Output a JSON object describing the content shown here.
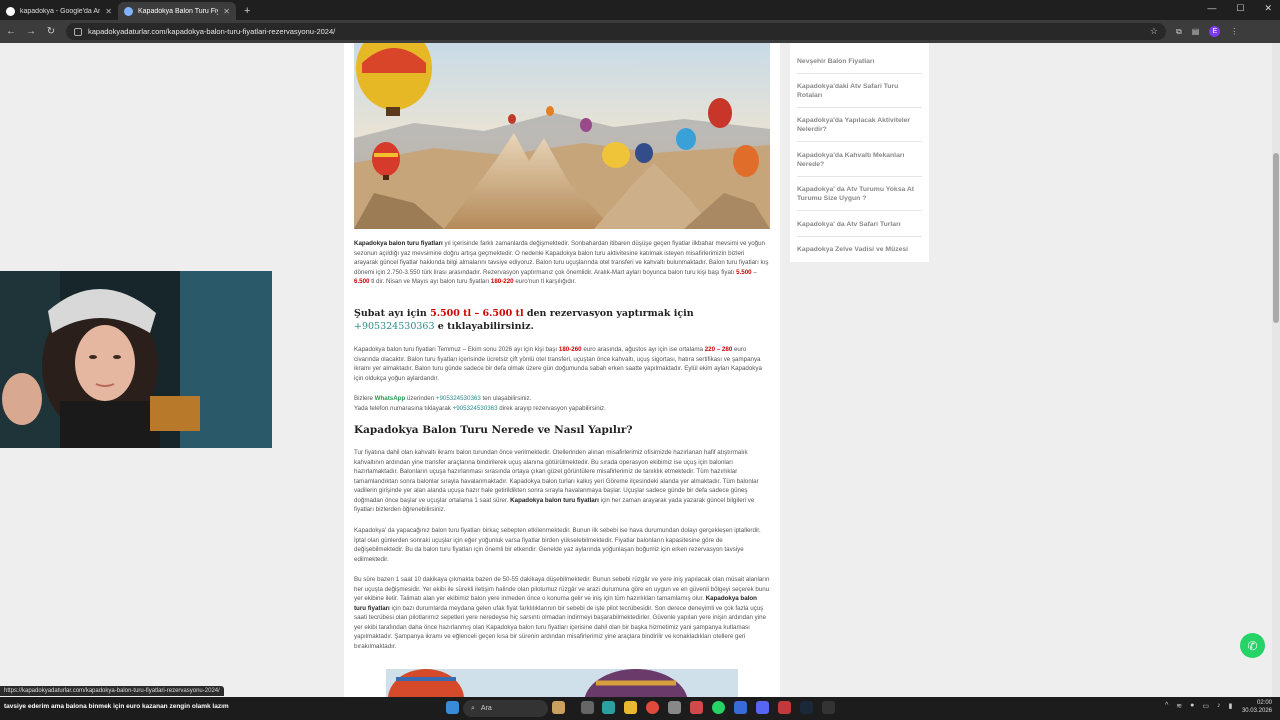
{
  "browser": {
    "tabs": [
      {
        "title": "kapadokya - Google'da Ara",
        "active": false
      },
      {
        "title": "Kapadokya Balon Turu Fiyatları",
        "active": true
      }
    ],
    "url": "kapadokyadaturlar.com/kapadokya-balon-turu-fiyatlari-rezervasyonu-2024/",
    "profile_initial": "E"
  },
  "sidebar": {
    "items": [
      "Nevşehir Balon Fiyatları",
      "Kapadokya'daki Atv Safari Turu Rotaları",
      "Kapadokya'da Yapılacak Aktiviteler Nelerdir?",
      "Kapadokya'da Kahvaltı Mekanları Nerede?",
      "Kapadokya' da Atv Turumu Yoksa At Turumu Size Uygun ?",
      "Kapadokya' da Atv Safari Turları",
      "Kapadokya Zelve Vadisi ve Müzesi"
    ]
  },
  "article": {
    "p1": {
      "bold": "Kapadokya balon turu fiyatları",
      "text1": " yıl içerisinde farklı zamanlarda değişmektedir. Sonbahardan itibaren düşüşe geçen fiyatlar ilkbahar mevsimi ve yoğun sezonun açıldığı yaz mevsimine doğru artışa geçmektedir. O nedenle Kapadokya balon turu aktivitesine katılmak isteyen misafirlerimizin bizleri arayarak güncel fiyatlar hakkında bilgi almalarını tavsiye ediyoruz. Balon turu uçuşlarında otel transferi ve kahvaltı bulunmaktadır. Balon turu fiyatları kış dönemi için 2.750-3.550 türk lirası arasındadır. Rezervasyon yaptırmanız çok önemlidir. Aralık-Mart ayları boyunca balon turu kişi başı fiyatı ",
      "red1": "5.500",
      "dash": " – ",
      "red2": "6.500",
      "text2": " tl dir. Nisan ve Mayıs ayı balon turu fiyatları ",
      "red3": "180-220",
      "text3": " euro'nun tl karşılığıdır."
    },
    "subheading": {
      "part1": "Şubat ayı için ",
      "price": "5.500 tl – 6.500 tl",
      "part2": " den rezervasyon yaptırmak için ",
      "phone": "+905324530363",
      "part3": " e tıklayabilirsiniz."
    },
    "p2": {
      "text1": "Kapadokya balon turu fiyatları Temmuz – Ekim sonu 2026 ayı için kişi başı ",
      "red1": "180-260",
      "text2": " euro arasında, ağustos ayı için ise ortalama ",
      "red2": "220 – 280",
      "text3": " euro civarında olacaktır. Balon turu fiyatları içerisinde ücretsiz çift yönlü otel transferi, uçuştan önce kahvaltı, uçuş sigortası, hatıra sertifikası ve şampanya ikramı yer almaktadır. Balon turu günde sadece bir defa olmak üzere gün doğumunda sabah erken saatte yapılmaktadır. Eylül ekim ayları Kapadokya için oldukça yoğun aylardandır."
    },
    "p3": {
      "line1a": "Bizlere ",
      "whatsapp": "WhatsApp",
      "line1b": " üzerinden ",
      "phone1": "+905324530363",
      "line1c": " ten ulaşabilirsiniz.",
      "line2a": "Yada telefon numarasına tıklayarak ",
      "phone2": "+905324530363",
      "line2b": " direk arayıp rezervasyon yapabilirsiniz."
    },
    "heading2": "Kapadokya Balon Turu Nerede ve Nasıl Yapılır?",
    "p4": {
      "text1": "Tur fiyatına dahil olan kahvaltı ikramı balon turundan önce verilmektedir. Otellerinden alınan misafirlerimiz ofisimizde hazırlanan hafif atıştırmalık kahvaltının ardından yine transfer araçlarına bindirilerek uçuş alanına götürülmektedir. Bu sırada operasyon ekibimiz ise uçuş için balonları hazırlamaktadır. Balonların uçuşa hazırlanması sırasında ortaya çıkan güzel görüntülere misafirlerimiz de tanıklık etmektedir. Tüm hazırlıklar tamamlandıktan sonra balonlar sırayla havalanmaktadır. Kapadokya balon turları kalkış yeri Göreme ilçesindeki alanda yer almaktadır. Tüm balonlar vadilerin girişinde yer alan alanda uçuşa hazır hale getirildikten sonra sırayla havalanmaya başlar. Uçuşlar sadece günde bir defa sadece güneş doğmadan önce başlar ve uçuşlar ortalama 1 saat sürer. ",
      "bold": "Kapadokya balon turu fiyatları",
      "text2": " için her zaman arayarak yada yazarak güncel bilgileri ve fiyatları bizlerden öğrenebilirsiniz."
    },
    "p5": "Kapadokya' da yapacağınız balon turu fiyatları birkaç sebepten etkilenmektedir. Bunun ilk sebebi ise hava durumundan dolayı gerçekleşen iptallerdir. İptal olan günlerden sonraki uçuşlar için eğer yoğunluk varsa fiyatlar birden yükselebilmektedir. Fiyatlar balonların kapasitesine göre de değişebilmektedir. Bu da balon turu fiyatları için önemli bir etkendir. Genelde yaz aylarında yoğunlaşan boğumiz için erken rezervasyon tavsiye edilmektedir.",
    "p6": {
      "text1": "Bu süre bazen 1 saat 10 dakikaya çıkmakta bazen de 50-55 dakikaya düşebilmektedir. Bunun sebebi rüzgâr ve yere iniş yapılacak olan müsait alanların her uçuşta değişmesidir. Yer ekibi ile sürekli iletişim halinde olan pilotumuz rüzgâr ve arazi durumuna göre en uygun ve en güvenli bölgeyi seçerek bunu yer ekibine iletir. Talimatı alan yer ekibimiz balon yere inmeden önce o konuma gelir ve iniş için tüm hazırlıkları tamamlamış olur. ",
      "bold": "Kapadokya balon turu fiyatları",
      "text2": " için bazı durumlarda meydana gelen ufak fiyat farklılıklarının bir sebebi de işte pilot tecrübesidir. Son derece deneyimli ve çok fazla uçuş saati tecrübesi olan pilotlarımız sepetleri yere neredeyse hiç sarsıntı olmadan indirmeyi başarabilmektedirler. Güvenle yapılan yere inişin ardından yine yer ekibi tarafından daha önce hazırlanmış olan Kapadokya balon turu fiyatları içerisine dahil olan bir başka hizmetimiz yani şampanya kutlaması yapılmaktadır. Şampanya ikramı ve eğlenceli geçen kısa bir sürenin ardından misafirlerimiz yine araçlara bindirilir ve konakladıkları otellere geri bırakılmaktadır."
    }
  },
  "status_url": "https://kapadokyadaturlar.com/kapadokya-balon-turu-fiyatlari-rezervasyonu-2024/",
  "stream_caption": "tavsiye ederim ama balona binmek için euro kazanan zengin olamk lazım",
  "taskbar": {
    "search_placeholder": "Ara",
    "time": "02:00",
    "date": "30.03.2026"
  },
  "colors": {
    "accent_red": "#d00000",
    "teal": "#2a8a8a",
    "whatsapp": "#25d366"
  }
}
